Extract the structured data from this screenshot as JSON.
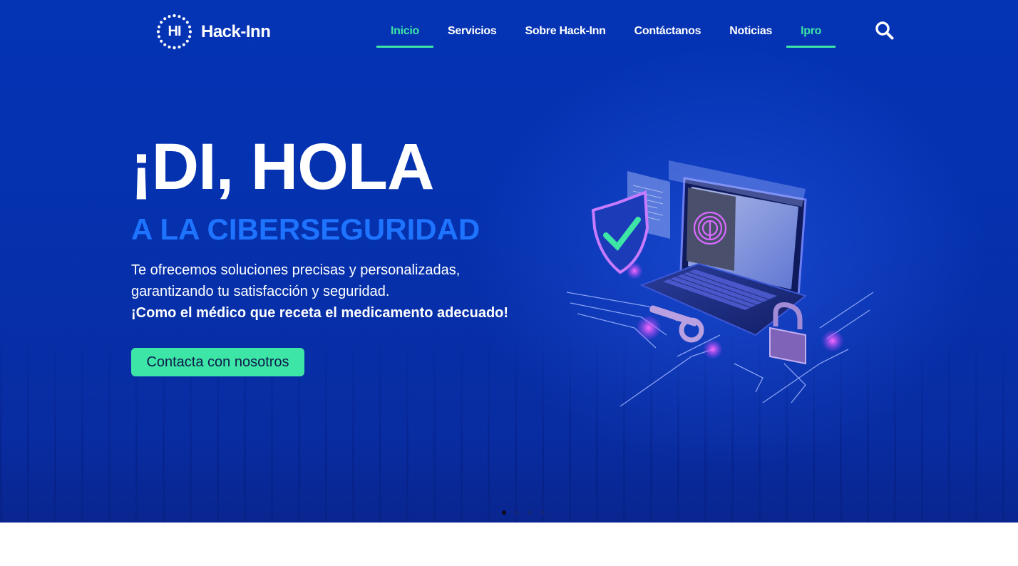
{
  "header": {
    "logo_text": "Hack-Inn",
    "logo_mark": "HI",
    "nav": [
      {
        "label": "Inicio",
        "active": true
      },
      {
        "label": "Servicios",
        "active": false
      },
      {
        "label": "Sobre Hack-Inn",
        "active": false
      },
      {
        "label": "Contáctanos",
        "active": false
      },
      {
        "label": "Noticias",
        "active": false
      },
      {
        "label": "Ipro",
        "active": true
      }
    ],
    "search_icon": "search-icon"
  },
  "hero": {
    "title": "¡DI, HOLA",
    "subtitle": "A LA CIBERSEGURIDAD",
    "description_line1": "Te ofrecemos soluciones precisas y personalizadas,",
    "description_line2": "garantizando tu satisfacción y seguridad.",
    "description_line3": "¡Como el médico que receta el medicamento adecuado!",
    "cta_label": "Contacta con nosotros",
    "slide_count": 4,
    "active_slide": 1
  },
  "colors": {
    "background": "#0433b4",
    "accent": "#3de5a6",
    "subtitle": "#1e73ff",
    "text": "#ffffff"
  }
}
